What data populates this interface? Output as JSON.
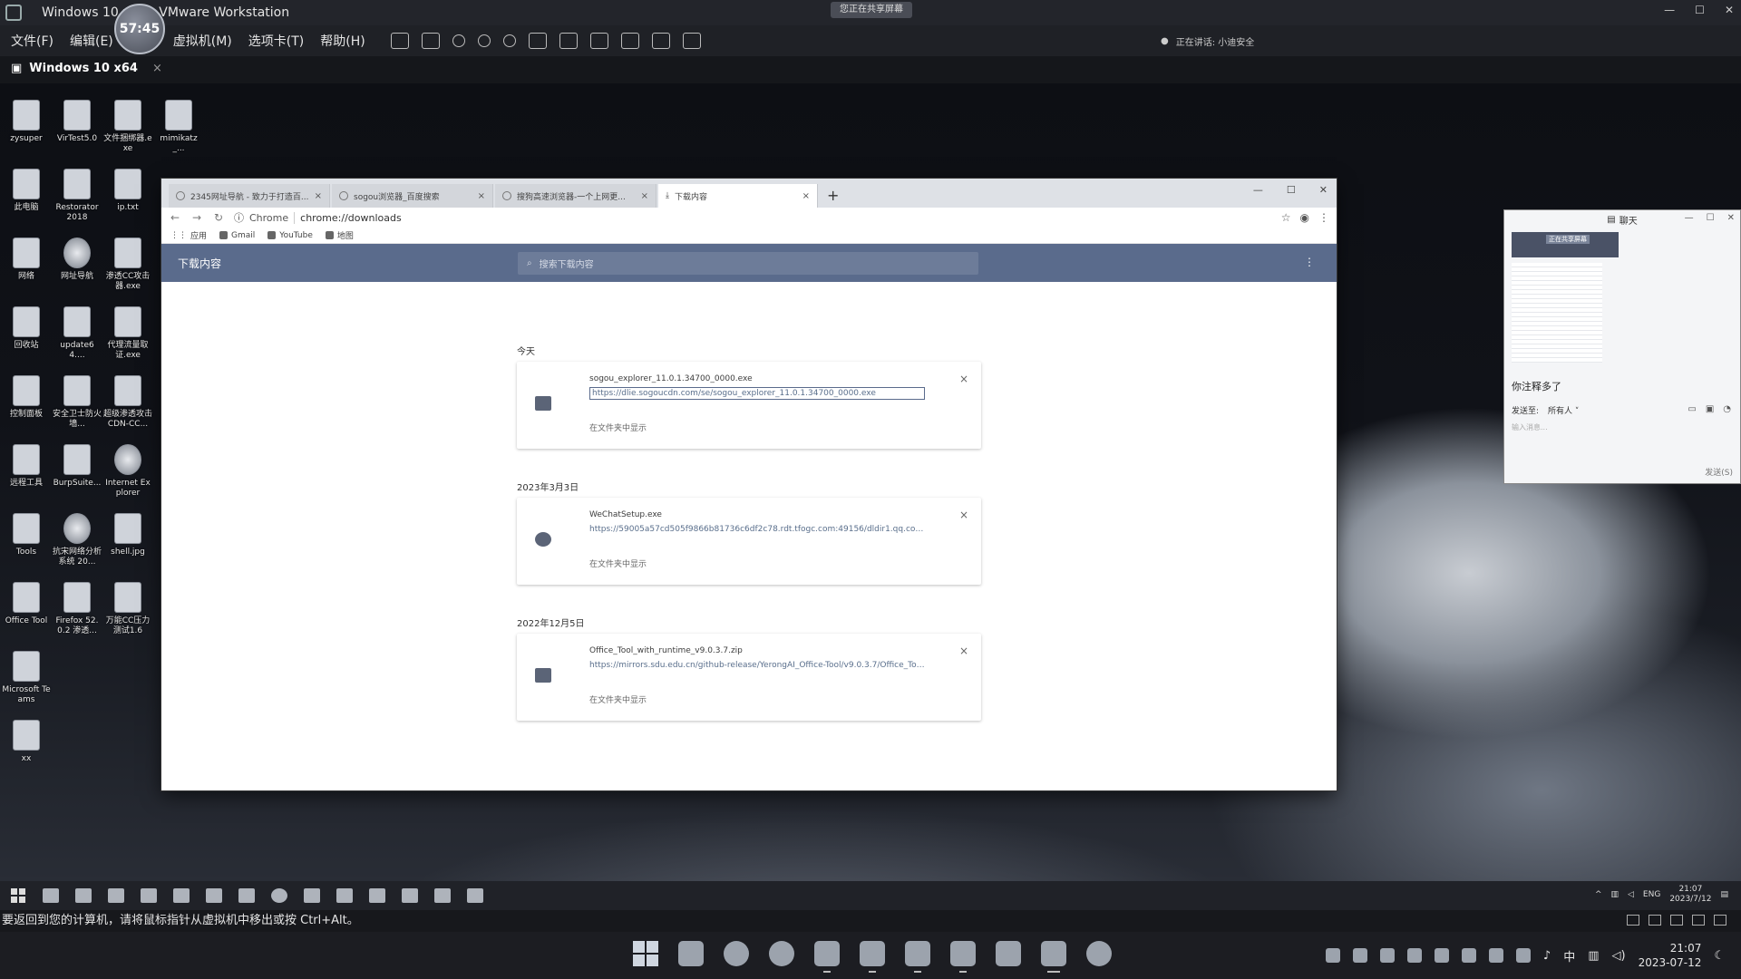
{
  "vm": {
    "title": "Windows 10 x64 - VMware Workstation",
    "timer": "57:45",
    "sharing": "您正在共享屏幕",
    "status": "正在讲话: 小迪安全",
    "menus": [
      "文件(F)",
      "编辑(E)",
      "虚拟机(M)",
      "选项卡(T)",
      "帮助(H)"
    ],
    "tab_label": "Windows 10 x64",
    "tab_close": "×",
    "window_controls": [
      "—",
      "☐",
      "✕"
    ]
  },
  "desktop": {
    "icons": [
      {
        "label": "zysuper",
        "icon": "app-icon"
      },
      {
        "label": "VirTest5.0",
        "icon": "file-icon"
      },
      {
        "label": "文件捆绑器.exe",
        "icon": "exe-icon"
      },
      {
        "label": "mimikatz_...",
        "icon": "file-icon"
      },
      {
        "label": "此电脑",
        "icon": "computer-icon"
      },
      {
        "label": "Restorator 2018",
        "icon": "file-icon"
      },
      {
        "label": "ip.txt",
        "icon": "text-file-icon"
      },
      {
        "label": "网络",
        "icon": "network-icon"
      },
      {
        "label": "网址导航",
        "icon": "browser-icon"
      },
      {
        "label": "渗透CC攻击器.exe",
        "icon": "exe-icon"
      },
      {
        "label": "回收站",
        "icon": "recycle-bin-icon"
      },
      {
        "label": "update64....",
        "icon": "file-icon"
      },
      {
        "label": "代理流量取证.exe",
        "icon": "exe-icon"
      },
      {
        "label": "控制面板",
        "icon": "control-panel-icon"
      },
      {
        "label": "安全卫士防火墙...",
        "icon": "file-icon"
      },
      {
        "label": "超级渗透攻击CDN-CC...",
        "icon": "exe-icon"
      },
      {
        "label": "远程工具",
        "icon": "file-icon"
      },
      {
        "label": "BurpSuite...",
        "icon": "file-icon"
      },
      {
        "label": "Internet Explorer",
        "icon": "ie-icon"
      },
      {
        "label": "Tools",
        "icon": "folder-icon"
      },
      {
        "label": "抗宋网络分析系统 20...",
        "icon": "browser-icon"
      },
      {
        "label": "shell.jpg",
        "icon": "image-icon"
      },
      {
        "label": "Office Tool",
        "icon": "file-icon"
      },
      {
        "label": "Firefox 52.0.2 渗透...",
        "icon": "file-icon"
      },
      {
        "label": "万能CC压力测试1.6",
        "icon": "file-icon"
      },
      {
        "label": "Microsoft Teams",
        "icon": "teams-icon"
      },
      {
        "label": "xx",
        "icon": "file-icon"
      }
    ]
  },
  "browser": {
    "tabs": [
      {
        "title": "2345网址导航 - 致力于打造百...",
        "close": "×"
      },
      {
        "title": "sogou浏览器_百度搜索",
        "close": "×"
      },
      {
        "title": "搜狗高速浏览器-一个上网更...",
        "close": "×"
      },
      {
        "title": "下载内容",
        "close": "×"
      }
    ],
    "new_tab": "+",
    "nav": {
      "back": "←",
      "forward": "→",
      "reload": "↻"
    },
    "url_chip": "Chrome",
    "url": "chrome://downloads",
    "star": "☆",
    "menu": "⋮",
    "bookmarks": [
      "应用",
      "Gmail",
      "YouTube",
      "地图"
    ],
    "window_controls": [
      "—",
      "☐",
      "✕"
    ]
  },
  "downloads": {
    "title": "下载内容",
    "search_placeholder": "搜索下载内容",
    "menu": "⋮",
    "groups": [
      {
        "date": "今天",
        "item": {
          "name": "sogou_explorer_11.0.1.34700_0000.exe",
          "url": "https://dlie.sogoucdn.com/se/sogou_explorer_11.0.1.34700_0000.exe",
          "action": "在文件夹中显示",
          "close": "×"
        }
      },
      {
        "date": "2023年3月3日",
        "item": {
          "name": "WeChatSetup.exe",
          "url": "https://59005a57cd505f9866b81736c6df2c78.rdt.tfogc.com:49156/dldir1.qq.com/...",
          "action": "在文件夹中显示",
          "close": "×"
        }
      },
      {
        "date": "2022年12月5日",
        "item": {
          "name": "Office_Tool_with_runtime_v9.0.3.7.zip",
          "url": "https://mirrors.sdu.edu.cn/github-release/YerongAI_Office-Tool/v9.0.3.7/Office_Tool...",
          "action": "在文件夹中显示",
          "close": "×"
        }
      }
    ]
  },
  "chat": {
    "title": "聊天",
    "thumb_label": "正在共享屏幕",
    "message": "你注释多了",
    "send_to_label": "发送至:",
    "send_to_value": "所有人 ˅",
    "input_placeholder": "输入消息...",
    "send_button": "发送(S)",
    "controls": [
      "—",
      "☐",
      "✕"
    ]
  },
  "guest_taskbar": {
    "tray_lang": "ENG",
    "time": "21:07",
    "date": "2023/7/12"
  },
  "host": {
    "status_text": "要返回到您的计算机，请将鼠标指针从虚拟机中移出或按 Ctrl+Alt。",
    "ime": "中",
    "time": "21:07",
    "date": "2023-07-12"
  }
}
